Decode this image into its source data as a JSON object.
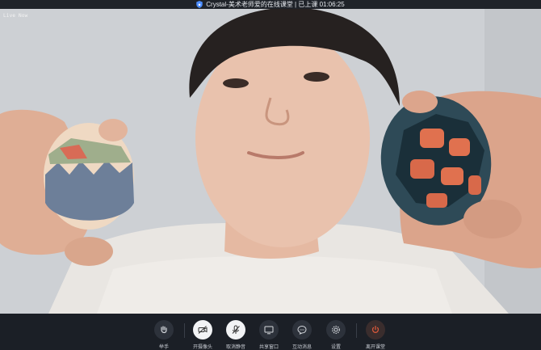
{
  "window": {
    "title": "Crystal-美术老师爱的在线课堂 | 已上课 01:06:25"
  },
  "video": {
    "live_label": "Live Now"
  },
  "toolbar": {
    "items": [
      {
        "label": "举手",
        "icon": "raise-hand-icon"
      },
      {
        "label": "开摄像头",
        "icon": "camera-off-icon"
      },
      {
        "label": "取消静音",
        "icon": "mic-off-icon"
      },
      {
        "label": "共享窗口",
        "icon": "share-screen-icon"
      },
      {
        "label": "互动消息",
        "icon": "chat-icon"
      },
      {
        "label": "设置",
        "icon": "gear-icon"
      },
      {
        "label": "离开课堂",
        "icon": "power-icon"
      }
    ]
  },
  "colors": {
    "accent_red": "#e05a3b",
    "toolbar_bg": "#1b1f26",
    "shield_blue": "#4c8dff"
  }
}
